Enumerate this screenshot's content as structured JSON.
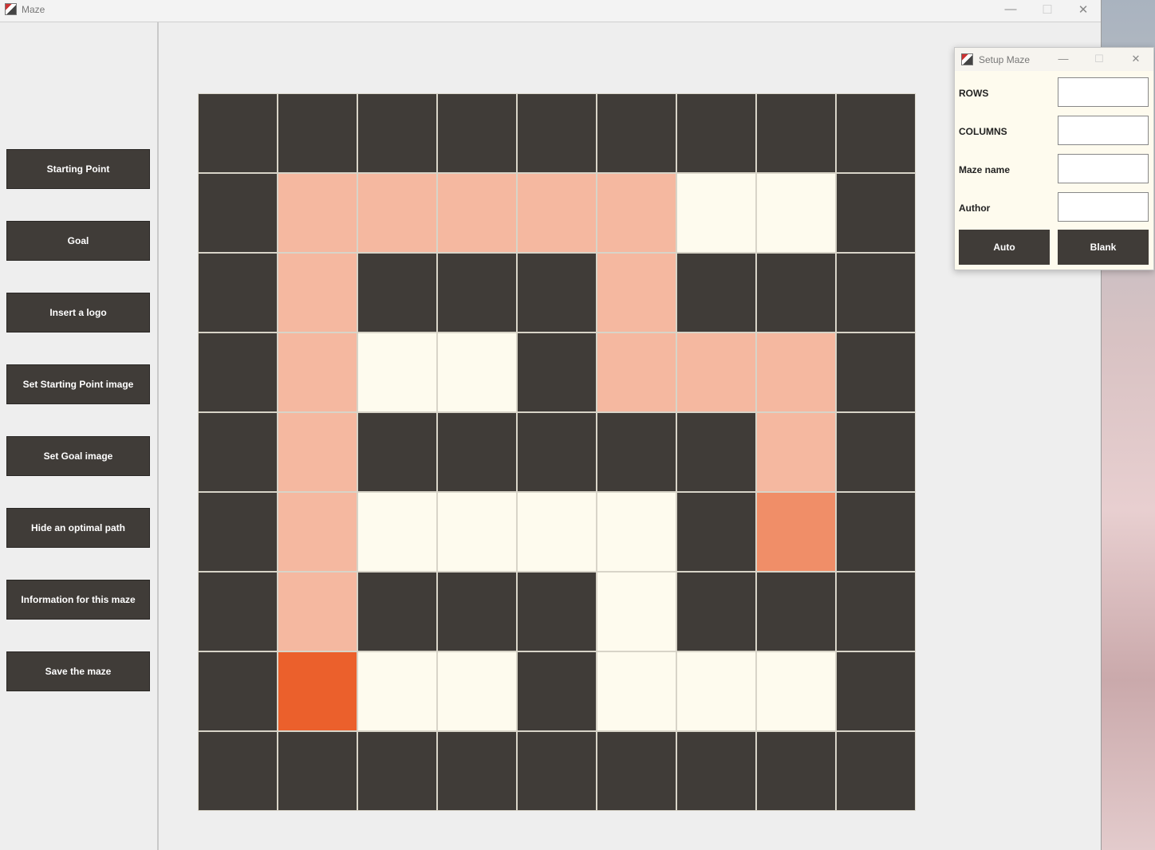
{
  "main_window": {
    "title": "Maze",
    "controls": {
      "minimize": "—",
      "maximize": "☐",
      "close": "✕"
    }
  },
  "sidebar": {
    "buttons": [
      {
        "label": "Starting Point"
      },
      {
        "label": "Goal"
      },
      {
        "label": "Insert a logo"
      },
      {
        "label": "Set Starting Point image"
      },
      {
        "label": "Set Goal image"
      },
      {
        "label": "Hide an optimal path"
      },
      {
        "label": "Information for this maze"
      },
      {
        "label": "Save the maze"
      }
    ]
  },
  "maze": {
    "rows": 9,
    "columns": 9,
    "legend": {
      "W": "wall",
      "O": "open",
      "P": "path",
      "G": "goal",
      "S": "start"
    },
    "colors": {
      "W": "#403c38",
      "O": "#fefbee",
      "P": "#f5b8a0",
      "G": "#f08e68",
      "S": "#eb602c"
    },
    "grid": [
      "WWWWWWWWW",
      "WPPPPPOOW",
      "WPWWWPWWW",
      "WPOOWPPPW",
      "WPWWWWWPW",
      "WPOOOOWGW",
      "WPWWWOWWW",
      "WSOOWOOOW",
      "WWWWWWWWW"
    ]
  },
  "setup_dialog": {
    "title": "Setup Maze",
    "controls": {
      "minimize": "—",
      "maximize": "☐",
      "close": "✕"
    },
    "fields": [
      {
        "label": "ROWS",
        "value": ""
      },
      {
        "label": "COLUMNS",
        "value": ""
      },
      {
        "label": "Maze name",
        "value": ""
      },
      {
        "label": "Author",
        "value": ""
      }
    ],
    "auto_label": "Auto",
    "blank_label": "Blank"
  }
}
